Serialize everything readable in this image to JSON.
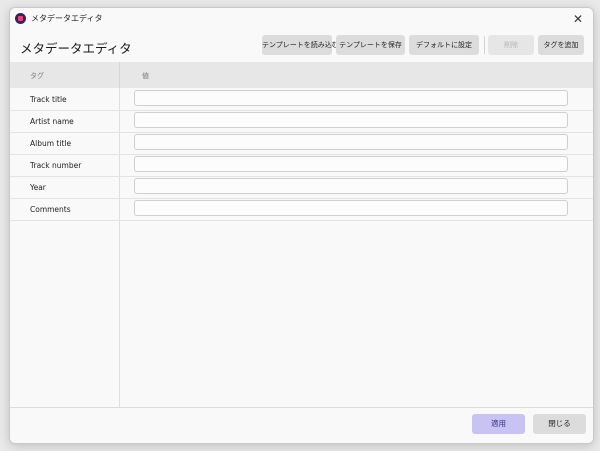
{
  "window": {
    "title": "メタデータエディタ",
    "close_glyph": "✕"
  },
  "header": {
    "title": "メタデータエディタ"
  },
  "toolbar": {
    "load_template": "テンプレートを読み込む",
    "save_template": "テンプレートを保存",
    "set_default": "デフォルトに設定",
    "delete": "削除",
    "add_tag": "タグを追加"
  },
  "table": {
    "columns": [
      "タグ",
      "値"
    ],
    "rows": [
      {
        "tag": "Track title",
        "value": ""
      },
      {
        "tag": "Artist name",
        "value": ""
      },
      {
        "tag": "Album title",
        "value": ""
      },
      {
        "tag": "Track number",
        "value": ""
      },
      {
        "tag": "Year",
        "value": ""
      },
      {
        "tag": "Comments",
        "value": ""
      }
    ]
  },
  "footer": {
    "apply": "適用",
    "close": "閉じる"
  },
  "colors": {
    "accent": "#c8c3f3",
    "accent_text": "#3a3580",
    "app_icon": "#e8427a"
  }
}
